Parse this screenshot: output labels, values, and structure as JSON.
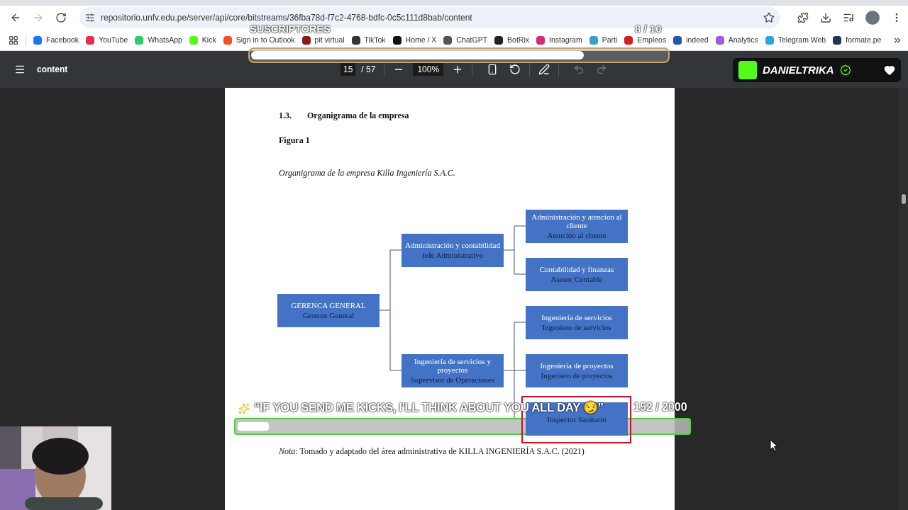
{
  "browser": {
    "url": "repositorio.unfv.edu.pe/server/api/core/bitstreams/36fba78d-f7c2-4768-bdfc-0c5c111d8bab/content",
    "bookmarks": [
      {
        "label": "Facebook",
        "color": "#1877f2"
      },
      {
        "label": "YouTube",
        "color": "#e62e4d"
      },
      {
        "label": "WhatsApp",
        "color": "#25d366"
      },
      {
        "label": "Kick",
        "color": "#53fc18"
      },
      {
        "label": "Sign in to Outlook",
        "color": "#f25022"
      },
      {
        "label": "pit virtual",
        "color": "#8b1a1a"
      },
      {
        "label": "TikTok",
        "color": "#333333"
      },
      {
        "label": "Home / X",
        "color": "#111111"
      },
      {
        "label": "ChatGPT",
        "color": "#555555"
      },
      {
        "label": "BotRix",
        "color": "#222222"
      },
      {
        "label": "Instagram",
        "color": "#d62976"
      },
      {
        "label": "Parti",
        "color": "#3aa0c8"
      },
      {
        "label": "Empleos",
        "color": "#d01f1f"
      },
      {
        "label": "indeed",
        "color": "#2557a7"
      },
      {
        "label": "Analytics",
        "color": "#9b5de5"
      },
      {
        "label": "Telegram Web",
        "color": "#2aa3e0"
      },
      {
        "label": "formate.pe",
        "color": "#1d3557"
      }
    ]
  },
  "pdf_toolbar": {
    "title": "content",
    "page": "15",
    "total": "/ 57",
    "zoom": "100%"
  },
  "document": {
    "heading_number": "1.3.",
    "heading": "Organigrama de la empresa",
    "figure_label": "Figura 1",
    "figure_caption": "Organigrama de la empresa Killa Ingeniería S.A.C.",
    "org_chart": {
      "title": "GERENCA GENERAL",
      "role": "Gerente General",
      "children": [
        {
          "title": "Administración y contabilidad",
          "role": "Jefe Administrativo",
          "children": [
            {
              "title": "Administración y atencion al cliente",
              "role": "Atención al cliente"
            },
            {
              "title": "Contabilidad y finanzas",
              "role": "Asesor Contable"
            }
          ]
        },
        {
          "title": "Ingeniería de servicios y proyectos",
          "role": "Supervisor de Operaciones",
          "children": [
            {
              "title": "Ingeniería de servicios",
              "role": "Ingeniero de servicios"
            },
            {
              "title": "Ingeniería de proyectos",
              "role": "Ingeniero de proyectos"
            },
            {
              "role": "Inspector Sanitario"
            }
          ]
        }
      ]
    },
    "note": "*Nota*: Tomado y adaptado del área administrativa de KILLA INGENIERÍA S.A.C. (2021)"
  },
  "overlays": {
    "subscriber_goal": {
      "label": "SUSCRIPTORES",
      "count": "8",
      "total": "/ 10",
      "level": 0.8
    },
    "channel_badge": {
      "name": "DANIELTRIKA",
      "verified": true
    },
    "kicks_goal": {
      "message": "“IF YOU SEND ME KICKS, I'LL THINK ABOUT YOU ALL DAY",
      "emoji": "😏”",
      "count": "152",
      "total": "/ 2000",
      "level": 0.07
    }
  }
}
